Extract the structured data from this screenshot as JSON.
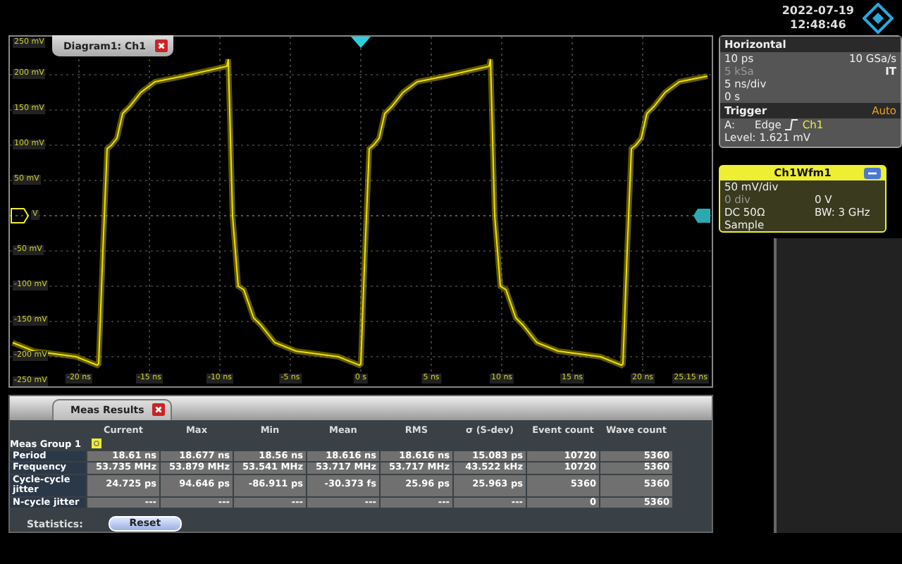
{
  "header": {
    "date": "2022-07-19",
    "time": "12:48:46"
  },
  "diagram": {
    "title": "Diagram1: Ch1",
    "y_labels": [
      "250 mV",
      "200 mV",
      "150 mV",
      "100 mV",
      "50 mV",
      "V",
      "-50 mV",
      "-100 mV",
      "-150 mV",
      "-200 mV",
      "-250 mV"
    ],
    "x_labels": [
      "-20 ns",
      "-15 ns",
      "-10 ns",
      "-5 ns",
      "0 s",
      "5 ns",
      "10 ns",
      "15 ns",
      "20 ns",
      "25.15 ns"
    ]
  },
  "horizontal": {
    "title": "Horizontal",
    "rows": [
      {
        "left": "10 ps",
        "right": "10 GSa/s",
        "dim": false
      },
      {
        "left": "5 kSa",
        "right": "IT",
        "dim": true
      },
      {
        "left": "5 ns/div",
        "dim": false
      },
      {
        "left": "0 s",
        "dim": false
      }
    ]
  },
  "trigger": {
    "title": "Trigger",
    "mode": "Auto",
    "source": "A:",
    "type": "Edge",
    "channel": "Ch1",
    "level": "Level: 1.621 mV"
  },
  "channel": {
    "title": "Ch1Wfm1",
    "rows": [
      {
        "left": "50 mV/div",
        "dim": false
      },
      {
        "left": "0 div",
        "right": "0 V",
        "dim": true
      },
      {
        "left": "DC 50Ω",
        "right": "BW: 3 GHz",
        "dim": false
      },
      {
        "left": "Sample",
        "dim": false
      }
    ]
  },
  "meas": {
    "title": "Meas Results",
    "group": "Meas Group 1",
    "columns": [
      "Current",
      "Max",
      "Min",
      "Mean",
      "RMS",
      "σ (S-dev)",
      "Event count",
      "Wave count"
    ],
    "rows": [
      {
        "label": "Period",
        "values": [
          "18.61 ns",
          "18.677 ns",
          "18.56 ns",
          "18.616 ns",
          "18.616 ns",
          "15.083 ps",
          "10720",
          "5360"
        ]
      },
      {
        "label": "Frequency",
        "values": [
          "53.735 MHz",
          "53.879 MHz",
          "53.541 MHz",
          "53.717 MHz",
          "53.717 MHz",
          "43.522 kHz",
          "10720",
          "5360"
        ]
      },
      {
        "label": "Cycle-cycle jitter",
        "values": [
          "24.725 ps",
          "94.646 ps",
          "-86.911 ps",
          "-30.373 fs",
          "25.96 ps",
          "25.963 ps",
          "5360",
          "5360"
        ]
      },
      {
        "label": "N-cycle jitter",
        "values": [
          "---",
          "---",
          "---",
          "---",
          "---",
          "---",
          "0",
          "5360"
        ]
      }
    ],
    "statistics_label": "Statistics:",
    "reset": "Reset"
  }
}
